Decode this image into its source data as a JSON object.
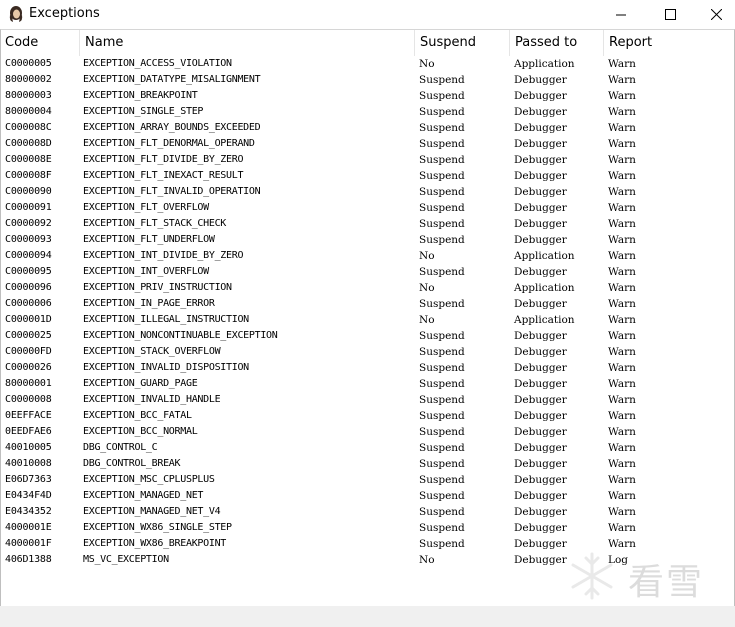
{
  "window": {
    "title": "Exceptions"
  },
  "columns": [
    "Code",
    "Name",
    "Suspend",
    "Passed to",
    "Report"
  ],
  "rows": [
    [
      "C0000005",
      "EXCEPTION_ACCESS_VIOLATION",
      "No",
      "Application",
      "Warn"
    ],
    [
      "80000002",
      "EXCEPTION_DATATYPE_MISALIGNMENT",
      "Suspend",
      "Debugger",
      "Warn"
    ],
    [
      "80000003",
      "EXCEPTION_BREAKPOINT",
      "Suspend",
      "Debugger",
      "Warn"
    ],
    [
      "80000004",
      "EXCEPTION_SINGLE_STEP",
      "Suspend",
      "Debugger",
      "Warn"
    ],
    [
      "C000008C",
      "EXCEPTION_ARRAY_BOUNDS_EXCEEDED",
      "Suspend",
      "Debugger",
      "Warn"
    ],
    [
      "C000008D",
      "EXCEPTION_FLT_DENORMAL_OPERAND",
      "Suspend",
      "Debugger",
      "Warn"
    ],
    [
      "C000008E",
      "EXCEPTION_FLT_DIVIDE_BY_ZERO",
      "Suspend",
      "Debugger",
      "Warn"
    ],
    [
      "C000008F",
      "EXCEPTION_FLT_INEXACT_RESULT",
      "Suspend",
      "Debugger",
      "Warn"
    ],
    [
      "C0000090",
      "EXCEPTION_FLT_INVALID_OPERATION",
      "Suspend",
      "Debugger",
      "Warn"
    ],
    [
      "C0000091",
      "EXCEPTION_FLT_OVERFLOW",
      "Suspend",
      "Debugger",
      "Warn"
    ],
    [
      "C0000092",
      "EXCEPTION_FLT_STACK_CHECK",
      "Suspend",
      "Debugger",
      "Warn"
    ],
    [
      "C0000093",
      "EXCEPTION_FLT_UNDERFLOW",
      "Suspend",
      "Debugger",
      "Warn"
    ],
    [
      "C0000094",
      "EXCEPTION_INT_DIVIDE_BY_ZERO",
      "No",
      "Application",
      "Warn"
    ],
    [
      "C0000095",
      "EXCEPTION_INT_OVERFLOW",
      "Suspend",
      "Debugger",
      "Warn"
    ],
    [
      "C0000096",
      "EXCEPTION_PRIV_INSTRUCTION",
      "No",
      "Application",
      "Warn"
    ],
    [
      "C0000006",
      "EXCEPTION_IN_PAGE_ERROR",
      "Suspend",
      "Debugger",
      "Warn"
    ],
    [
      "C000001D",
      "EXCEPTION_ILLEGAL_INSTRUCTION",
      "No",
      "Application",
      "Warn"
    ],
    [
      "C0000025",
      "EXCEPTION_NONCONTINUABLE_EXCEPTION",
      "Suspend",
      "Debugger",
      "Warn"
    ],
    [
      "C00000FD",
      "EXCEPTION_STACK_OVERFLOW",
      "Suspend",
      "Debugger",
      "Warn"
    ],
    [
      "C0000026",
      "EXCEPTION_INVALID_DISPOSITION",
      "Suspend",
      "Debugger",
      "Warn"
    ],
    [
      "80000001",
      "EXCEPTION_GUARD_PAGE",
      "Suspend",
      "Debugger",
      "Warn"
    ],
    [
      "C0000008",
      "EXCEPTION_INVALID_HANDLE",
      "Suspend",
      "Debugger",
      "Warn"
    ],
    [
      "0EEFFACE",
      "EXCEPTION_BCC_FATAL",
      "Suspend",
      "Debugger",
      "Warn"
    ],
    [
      "0EEDFAE6",
      "EXCEPTION_BCC_NORMAL",
      "Suspend",
      "Debugger",
      "Warn"
    ],
    [
      "40010005",
      "DBG_CONTROL_C",
      "Suspend",
      "Debugger",
      "Warn"
    ],
    [
      "40010008",
      "DBG_CONTROL_BREAK",
      "Suspend",
      "Debugger",
      "Warn"
    ],
    [
      "E06D7363",
      "EXCEPTION_MSC_CPLUSPLUS",
      "Suspend",
      "Debugger",
      "Warn"
    ],
    [
      "E0434F4D",
      "EXCEPTION_MANAGED_NET",
      "Suspend",
      "Debugger",
      "Warn"
    ],
    [
      "E0434352",
      "EXCEPTION_MANAGED_NET_V4",
      "Suspend",
      "Debugger",
      "Warn"
    ],
    [
      "4000001E",
      "EXCEPTION_WX86_SINGLE_STEP",
      "Suspend",
      "Debugger",
      "Warn"
    ],
    [
      "4000001F",
      "EXCEPTION_WX86_BREAKPOINT",
      "Suspend",
      "Debugger",
      "Warn"
    ],
    [
      "406D1388",
      "MS_VC_EXCEPTION",
      "No",
      "Debugger",
      "Log"
    ]
  ],
  "watermark": {
    "text": "看雪",
    "icon": "snowflake-icon"
  },
  "icons": {
    "app": "app-icon",
    "minimize": "minimize-icon",
    "maximize": "maximize-icon",
    "close": "close-icon"
  }
}
